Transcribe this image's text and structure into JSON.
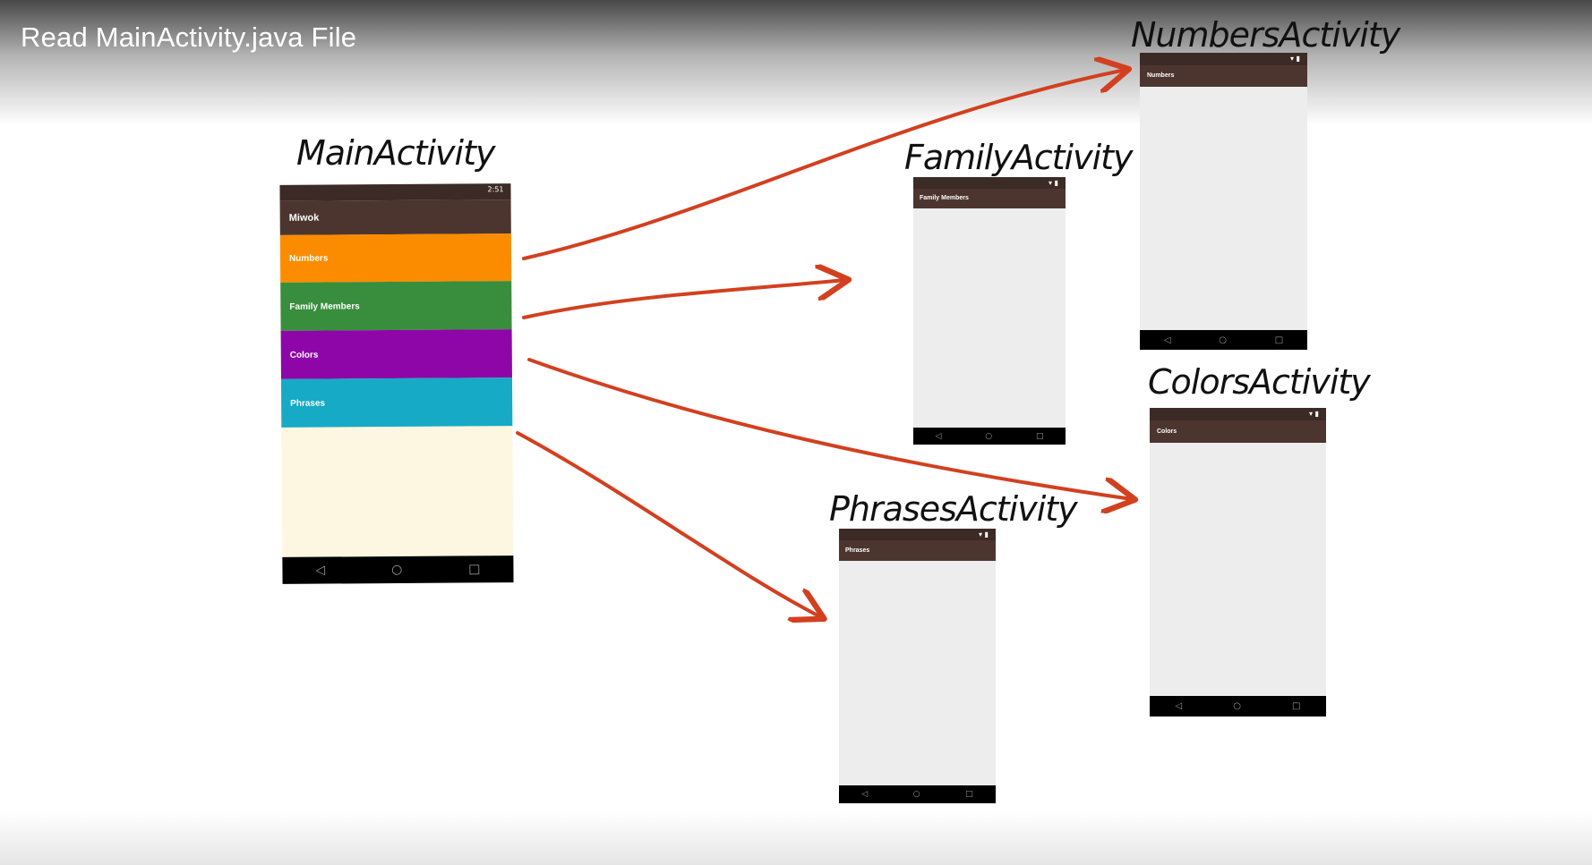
{
  "video": {
    "title": "Read MainActivity.java File"
  },
  "main_activity": {
    "label": "MainActivity",
    "app_bar_title": "Miwok",
    "status_time": "2:51",
    "categories": [
      {
        "label": "Numbers",
        "color": "#fb8c00"
      },
      {
        "label": "Family Members",
        "color": "#388e3c"
      },
      {
        "label": "Colors",
        "color": "#8e06a8"
      },
      {
        "label": "Phrases",
        "color": "#16aac7"
      }
    ],
    "list_background": "#fdf6e0"
  },
  "numbers_activity": {
    "label": "NumbersActivity",
    "app_bar_title": "Numbers"
  },
  "family_activity": {
    "label": "FamilyActivity",
    "app_bar_title": "Family Members"
  },
  "colors_activity": {
    "label": "ColorsActivity",
    "app_bar_title": "Colors"
  },
  "phrases_activity": {
    "label": "PhrasesActivity",
    "app_bar_title": "Phrases"
  },
  "nav_icons": {
    "back": "◁",
    "home": "○",
    "recents": "□"
  },
  "colors": {
    "arrow": "#d2401f",
    "status_bar": "#3c2a26",
    "app_bar": "#4d352f",
    "screen_background": "#ededed",
    "nav_bar": "#000000"
  }
}
